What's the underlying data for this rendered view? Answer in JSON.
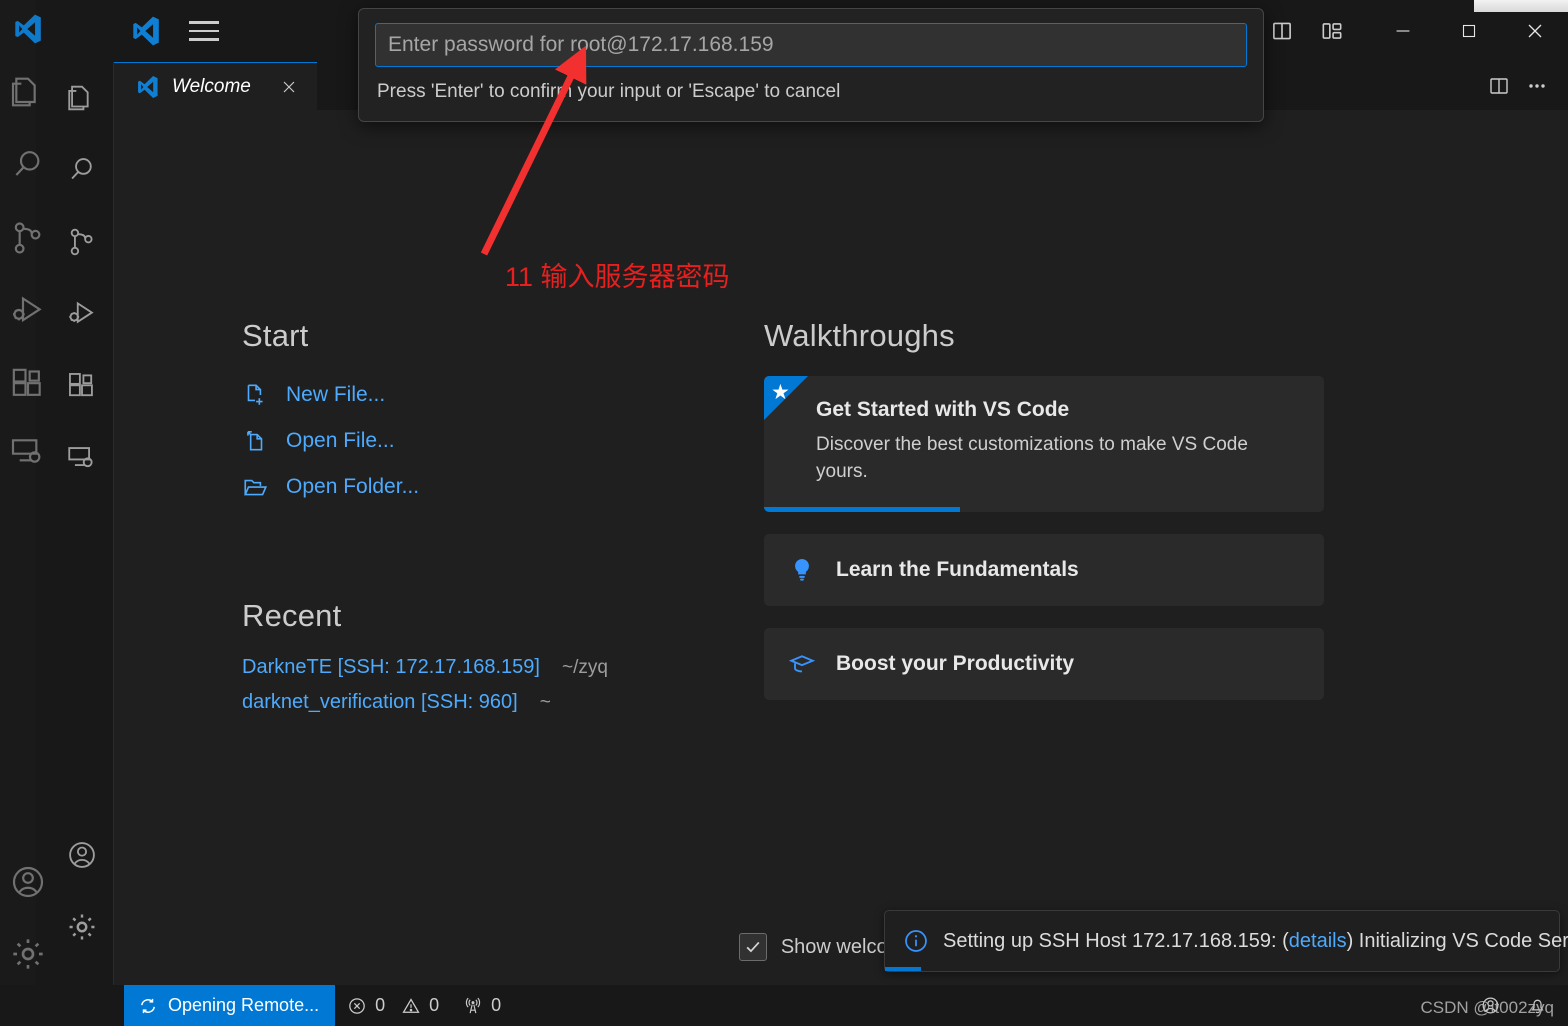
{
  "titlebar": {
    "app_icon": "vscode-logo-icon",
    "menu_label": "application-menu",
    "layout_buttons": [
      {
        "name": "toggle-panel-icon",
        "label": "Toggle Panel"
      },
      {
        "name": "toggle-secondary-sidebar-icon",
        "label": "Toggle Secondary Side Bar"
      },
      {
        "name": "customize-layout-icon",
        "label": "Customize Layout"
      }
    ],
    "window_controls": [
      {
        "name": "minimize-button",
        "label": "Minimize"
      },
      {
        "name": "maximize-button",
        "label": "Maximize"
      },
      {
        "name": "close-button",
        "label": "Close"
      }
    ]
  },
  "activitybar": {
    "items": [
      {
        "name": "explorer",
        "label": "Explorer",
        "icon": "files-icon"
      },
      {
        "name": "search",
        "label": "Search",
        "icon": "search-icon"
      },
      {
        "name": "source-control",
        "label": "Source Control",
        "icon": "source-control-icon"
      },
      {
        "name": "run-and-debug",
        "label": "Run and Debug",
        "icon": "debug-icon"
      },
      {
        "name": "extensions",
        "label": "Extensions",
        "icon": "extensions-icon"
      },
      {
        "name": "remote-explorer",
        "label": "Remote Explorer",
        "icon": "remote-explorer-icon"
      }
    ],
    "bottom_items": [
      {
        "name": "accounts",
        "label": "Accounts",
        "icon": "account-icon"
      },
      {
        "name": "manage",
        "label": "Manage",
        "icon": "gear-icon"
      }
    ]
  },
  "tabs": [
    {
      "label": "Welcome",
      "icon": "vscode-logo-icon",
      "active": true,
      "close_label": "Close"
    }
  ],
  "editor_actions": [
    {
      "name": "split-editor-icon",
      "label": "Split Editor Right"
    },
    {
      "name": "more-actions-icon",
      "label": "More Actions..."
    }
  ],
  "welcome": {
    "start": {
      "title": "Start",
      "items": [
        {
          "label": "New File...",
          "icon": "new-file-icon"
        },
        {
          "label": "Open File...",
          "icon": "open-file-icon"
        },
        {
          "label": "Open Folder...",
          "icon": "open-folder-icon"
        }
      ]
    },
    "recent": {
      "title": "Recent",
      "items": [
        {
          "name": "DarkneTE [SSH: 172.17.168.159]",
          "path": "~/zyq"
        },
        {
          "name": "darknet_verification [SSH: 960]",
          "path": "~"
        }
      ]
    },
    "walkthroughs": {
      "title": "Walkthroughs",
      "featured": {
        "title": "Get Started with VS Code",
        "description": "Discover the best customizations to make VS Code yours.",
        "progress_percent": 35,
        "badge_icon": "star-icon"
      },
      "items": [
        {
          "title": "Learn the Fundamentals",
          "icon": "lightbulb-icon"
        },
        {
          "title": "Boost your Productivity",
          "icon": "mortarboard-icon"
        }
      ]
    },
    "footer": {
      "checkbox_checked": true,
      "label": "Show welcome pa"
    }
  },
  "quickinput": {
    "placeholder": "Enter password for root@172.17.168.159",
    "value": "",
    "hint": "Press 'Enter' to confirm your input or 'Escape' to cancel"
  },
  "annotation": {
    "text": "11 输入服务器密码",
    "color": "#e81f1f"
  },
  "notification": {
    "icon": "info-icon",
    "text_before": "Setting up SSH Host 172.17.168.159: (",
    "link": "details",
    "text_after": ") Initializing VS Code Server"
  },
  "statusbar": {
    "remote": {
      "label": "Opening Remote...",
      "icon": "sync-icon"
    },
    "problems": [
      {
        "icon": "error-icon",
        "value": "0"
      },
      {
        "icon": "warning-icon",
        "value": "0"
      }
    ],
    "ports": {
      "icon": "radio-tower-icon",
      "value": "0"
    },
    "right_items": [
      {
        "name": "account-icon",
        "label": "Accounts"
      },
      {
        "name": "bell-icon",
        "label": "Notifications"
      }
    ]
  },
  "watermark": {
    "text": "CSDN @it002zyq"
  },
  "colors": {
    "accent": "#0078d4",
    "link": "#4daafc",
    "editor_bg": "#1f1f1f",
    "chrome_bg": "#181818",
    "annotation_red": "#e81f1f"
  }
}
